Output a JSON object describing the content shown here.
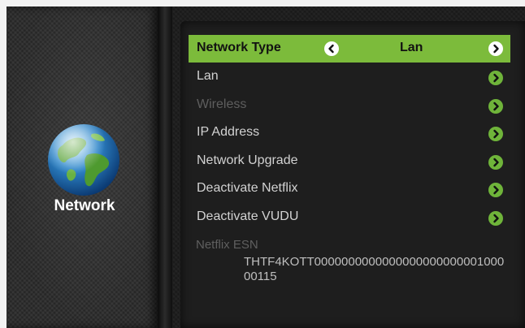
{
  "section": {
    "title": "Network",
    "icon": "globe-icon"
  },
  "colors": {
    "accent": "#7cbb3b",
    "text": "#d2d2d2",
    "disabled": "#5e5e5e"
  },
  "menu": {
    "network_type": {
      "label": "Network Type",
      "value": "Lan"
    },
    "items": [
      {
        "label": "Lan",
        "enabled": true
      },
      {
        "label": "Wireless",
        "enabled": false
      },
      {
        "label": "IP Address",
        "enabled": true
      },
      {
        "label": "Network Upgrade",
        "enabled": true
      },
      {
        "label": "Deactivate Netflix",
        "enabled": true
      },
      {
        "label": "Deactivate VUDU",
        "enabled": true
      }
    ]
  },
  "netflix_esn": {
    "label": "Netflix ESN",
    "value": "THTF4KOTT000000000000000000000000100000115"
  }
}
